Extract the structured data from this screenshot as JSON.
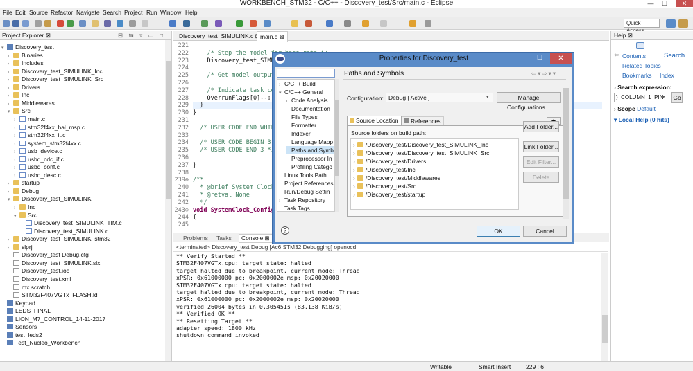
{
  "window": {
    "title": "WORKBENCH_STM32 - C/C++ - Discovery_test/Src/main.c - Eclipse",
    "min": "—",
    "max": "☐",
    "close": "✕"
  },
  "menu": [
    "File",
    "Edit",
    "Source",
    "Refactor",
    "Navigate",
    "Search",
    "Project",
    "Run",
    "Window",
    "Help"
  ],
  "toolbar": {
    "quick_access": "Quick Access"
  },
  "project_explorer": {
    "title": "Project Explorer ⊠",
    "items": [
      {
        "label": "Discovery_test",
        "tw": "▾",
        "icon": "proj"
      },
      {
        "label": "Binaries",
        "tw": "›",
        "icon": "fold"
      },
      {
        "label": "Includes",
        "tw": "›",
        "icon": "fold"
      },
      {
        "label": "Discovery_test_SIMULINK_Inc",
        "tw": "›",
        "icon": "fold"
      },
      {
        "label": "Discovery_test_SIMULINK_Src",
        "tw": "›",
        "icon": "fold"
      },
      {
        "label": "Drivers",
        "tw": "›",
        "icon": "fold"
      },
      {
        "label": "Inc",
        "tw": "›",
        "icon": "fold"
      },
      {
        "label": "Middlewares",
        "tw": "›",
        "icon": "fold"
      },
      {
        "label": "Src",
        "tw": "▾",
        "icon": "fold"
      },
      {
        "label": "main.c",
        "tw": "›",
        "icon": "cfile"
      },
      {
        "label": "stm32f4xx_hal_msp.c",
        "tw": "›",
        "icon": "cfile"
      },
      {
        "label": "stm32f4xx_it.c",
        "tw": "›",
        "icon": "cfile"
      },
      {
        "label": "system_stm32f4xx.c",
        "tw": "›",
        "icon": "cfile"
      },
      {
        "label": "usb_device.c",
        "tw": "›",
        "icon": "cfile"
      },
      {
        "label": "usbd_cdc_if.c",
        "tw": "›",
        "icon": "cfile"
      },
      {
        "label": "usbd_conf.c",
        "tw": "›",
        "icon": "cfile"
      },
      {
        "label": "usbd_desc.c",
        "tw": "›",
        "icon": "cfile"
      },
      {
        "label": "startup",
        "tw": "›",
        "icon": "fold"
      },
      {
        "label": "Debug",
        "tw": "›",
        "icon": "fold"
      },
      {
        "label": "Discovery_test_SIMULINK",
        "tw": "▾",
        "icon": "fold"
      },
      {
        "label": "Inc",
        "tw": "›",
        "icon": "fold"
      },
      {
        "label": "Src",
        "tw": "▾",
        "icon": "fold"
      },
      {
        "label": "Discovery_test_SIMULINK_TIM.c",
        "tw": "",
        "icon": "cfile"
      },
      {
        "label": "Discovery_test_SIMULINK.c",
        "tw": "",
        "icon": "cfile"
      },
      {
        "label": "Discovery_test_SIMULINK_stm32",
        "tw": "›",
        "icon": "fold"
      },
      {
        "label": "slprj",
        "tw": "›",
        "icon": "fold"
      },
      {
        "label": "Discovery_test Debug.cfg",
        "tw": "",
        "icon": "xfile"
      },
      {
        "label": "Discovery_test_SIMULINK.slx",
        "tw": "",
        "icon": "xfile"
      },
      {
        "label": "Discovery_test.ioc",
        "tw": "",
        "icon": "xfile"
      },
      {
        "label": "Discovery_test.xml",
        "tw": "",
        "icon": "xfile"
      },
      {
        "label": "mx.scratch",
        "tw": "",
        "icon": "xfile"
      },
      {
        "label": "STM32F407VGTx_FLASH.ld",
        "tw": "",
        "icon": "xfile"
      },
      {
        "label": "Keypad",
        "tw": "",
        "icon": "proj"
      },
      {
        "label": "LEDS_FINAL",
        "tw": "",
        "icon": "proj"
      },
      {
        "label": "LION_M7_CONTROL_14-11-2017",
        "tw": "",
        "icon": "proj"
      },
      {
        "label": "Sensors",
        "tw": "",
        "icon": "proj"
      },
      {
        "label": "test_leds2",
        "tw": "",
        "icon": "proj"
      },
      {
        "label": "Test_Nucleo_Workbench",
        "tw": "",
        "icon": "proj"
      }
    ]
  },
  "editor": {
    "tabs": [
      "Discovery_test_SIMULINK.c ⊠",
      "main.c ⊠"
    ],
    "lines": [
      {
        "n": "221",
        "t": ""
      },
      {
        "n": "222",
        "t": "    /* Step the model for base rate */",
        "c": "cm"
      },
      {
        "n": "223",
        "t": "    Discovery_test_SIMULINK_step();"
      },
      {
        "n": "224",
        "t": ""
      },
      {
        "n": "225",
        "t": "    /* Get model outputs here */",
        "c": "cm"
      },
      {
        "n": "226",
        "t": ""
      },
      {
        "n": "227",
        "t": "    /* Indicate task complete */",
        "c": "cm"
      },
      {
        "n": "228",
        "t": "    OverrunFlags[0]--;"
      },
      {
        "n": "229",
        "t": "  }"
      },
      {
        "n": "230",
        "t": "}"
      },
      {
        "n": "231",
        "t": ""
      },
      {
        "n": "232",
        "t": "  /* USER CODE END WHILE */",
        "c": "cm"
      },
      {
        "n": "233",
        "t": ""
      },
      {
        "n": "234",
        "t": "  /* USER CODE BEGIN 3 */",
        "c": "cm"
      },
      {
        "n": "235",
        "t": "  /* USER CODE END 3 */",
        "c": "cm"
      },
      {
        "n": "236",
        "t": ""
      },
      {
        "n": "237",
        "t": "}"
      },
      {
        "n": "238",
        "t": ""
      },
      {
        "n": "239⊖",
        "t": "/**",
        "c": "cm"
      },
      {
        "n": "240",
        "t": "  * @brief System Clock Configuration",
        "c": "cm"
      },
      {
        "n": "241",
        "t": "  * @retval None",
        "c": "cm"
      },
      {
        "n": "242",
        "t": "  */",
        "c": "cm"
      },
      {
        "n": "243⊖",
        "t": "void SystemClock_Config(void)",
        "c": "kw"
      },
      {
        "n": "244",
        "t": "{"
      },
      {
        "n": "245",
        "t": ""
      }
    ]
  },
  "console": {
    "tabs": [
      "Problems",
      "Tasks",
      "Console ⊠"
    ],
    "header": "<terminated> Discovery_test Debug [Ac6 STM32 Debugging] openocd",
    "lines": [
      "** Verify Started **",
      "STM32F407VGTx.cpu: target state: halted",
      "target halted due to breakpoint, current mode: Thread",
      "xPSR: 0x61000000 pc: 0x2000002e msp: 0x20020000",
      "STM32F407VGTx.cpu: target state: halted",
      "target halted due to breakpoint, current mode: Thread",
      "xPSR: 0x61000000 pc: 0x2000002e msp: 0x20020000",
      "verified 26004 bytes in 0.305451s (83.138 KiB/s)",
      "** Verified OK **",
      "** Resetting Target **",
      "adapter speed: 1800 kHz",
      "shutdown command invoked"
    ]
  },
  "help": {
    "title": "Help ⊠",
    "contents": "Contents",
    "search": "Search",
    "related": "Related Topics",
    "bookmarks": "Bookmarks",
    "index": "Index",
    "search_expr_label": "Search expression:",
    "search_expr_value": ")_COLUMN_1_PIN",
    "go": "Go",
    "scope_label": "Scope",
    "scope_value": "Default",
    "local_help": "Local Help (0 hits)"
  },
  "dialog": {
    "title": "Properties for Discovery_test",
    "filter_placeholder": "",
    "nav": [
      {
        "label": "C/C++ Build",
        "tw": "›",
        "indent": 1
      },
      {
        "label": "C/C++ General",
        "tw": "▾",
        "indent": 1
      },
      {
        "label": "Code Analysis",
        "tw": "›",
        "indent": 2
      },
      {
        "label": "Documentation",
        "tw": "",
        "indent": 2
      },
      {
        "label": "File Types",
        "tw": "",
        "indent": 2
      },
      {
        "label": "Formatter",
        "tw": "",
        "indent": 2
      },
      {
        "label": "Indexer",
        "tw": "",
        "indent": 2
      },
      {
        "label": "Language Mapp",
        "tw": "",
        "indent": 2
      },
      {
        "label": "Paths and Symb",
        "tw": "",
        "indent": 2
      },
      {
        "label": "Preprocessor In",
        "tw": "",
        "indent": 2
      },
      {
        "label": "Profiling Catego",
        "tw": "",
        "indent": 2
      },
      {
        "label": "Linux Tools Path",
        "tw": "",
        "indent": 1
      },
      {
        "label": "Project References",
        "tw": "",
        "indent": 1
      },
      {
        "label": "Run/Debug Settin",
        "tw": "",
        "indent": 1
      },
      {
        "label": "Task Repository",
        "tw": "›",
        "indent": 1
      },
      {
        "label": "Task Tags",
        "tw": "",
        "indent": 1
      }
    ],
    "page_title": "Paths and Symbols",
    "config_label": "Configuration:",
    "config_value": "Debug  [ Active ]",
    "manage_btn": "Manage Configurations...",
    "tab_source": "Source Location",
    "tab_refs": "References",
    "folders_label": "Source folders on build path:",
    "folders": [
      "/Discovery_test/Discovery_test_SIMULINK_Inc",
      "/Discovery_test/Discovery_test_SIMULINK_Src",
      "/Discovery_test/Drivers",
      "/Discovery_test/Inc",
      "/Discovery_test/Middlewares",
      "/Discovery_test/Src",
      "/Discovery_test/startup"
    ],
    "add_folder": "Add Folder...",
    "link_folder": "Link Folder...",
    "edit_filter": "Edit Filter...",
    "delete": "Delete",
    "ok": "OK",
    "cancel": "Cancel",
    "help_icon": "?"
  },
  "status": {
    "mode": "Writable",
    "insert": "Smart Insert",
    "position": "229 : 6"
  }
}
